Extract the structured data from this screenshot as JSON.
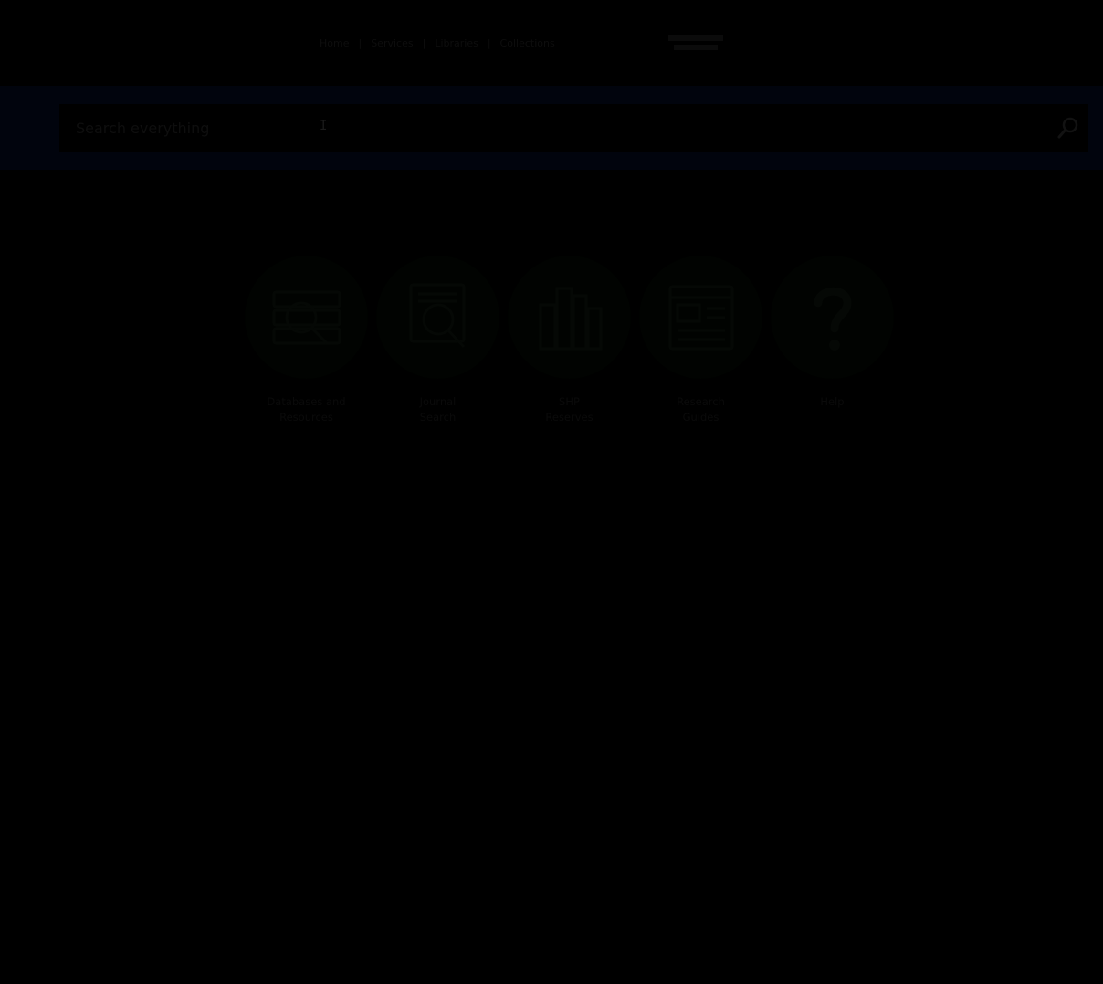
{
  "colors": {
    "page_bg": "#000000",
    "search_band_bg": "#01040d",
    "tile_circle_bg": "#010301",
    "icon_stroke": "#050805"
  },
  "header": {
    "nav": [
      {
        "label": "Home"
      },
      {
        "label": "Services"
      },
      {
        "label": "Libraries"
      },
      {
        "label": "Collections"
      }
    ],
    "brand": "Library logo"
  },
  "search": {
    "placeholder": "Search everything",
    "value": "",
    "button_icon": "search-icon"
  },
  "tiles": [
    {
      "label_line1": "Databases and",
      "label_line2": "Resources",
      "icon": "database-search-icon"
    },
    {
      "label_line1": "Journal",
      "label_line2": "Search",
      "icon": "journal-search-icon"
    },
    {
      "label_line1": "SHP",
      "label_line2": "Reserves",
      "icon": "books-icon"
    },
    {
      "label_line1": "Research",
      "label_line2": "Guides",
      "icon": "guide-page-icon"
    },
    {
      "label_line1": "Help",
      "label_line2": "",
      "icon": "question-icon"
    }
  ]
}
